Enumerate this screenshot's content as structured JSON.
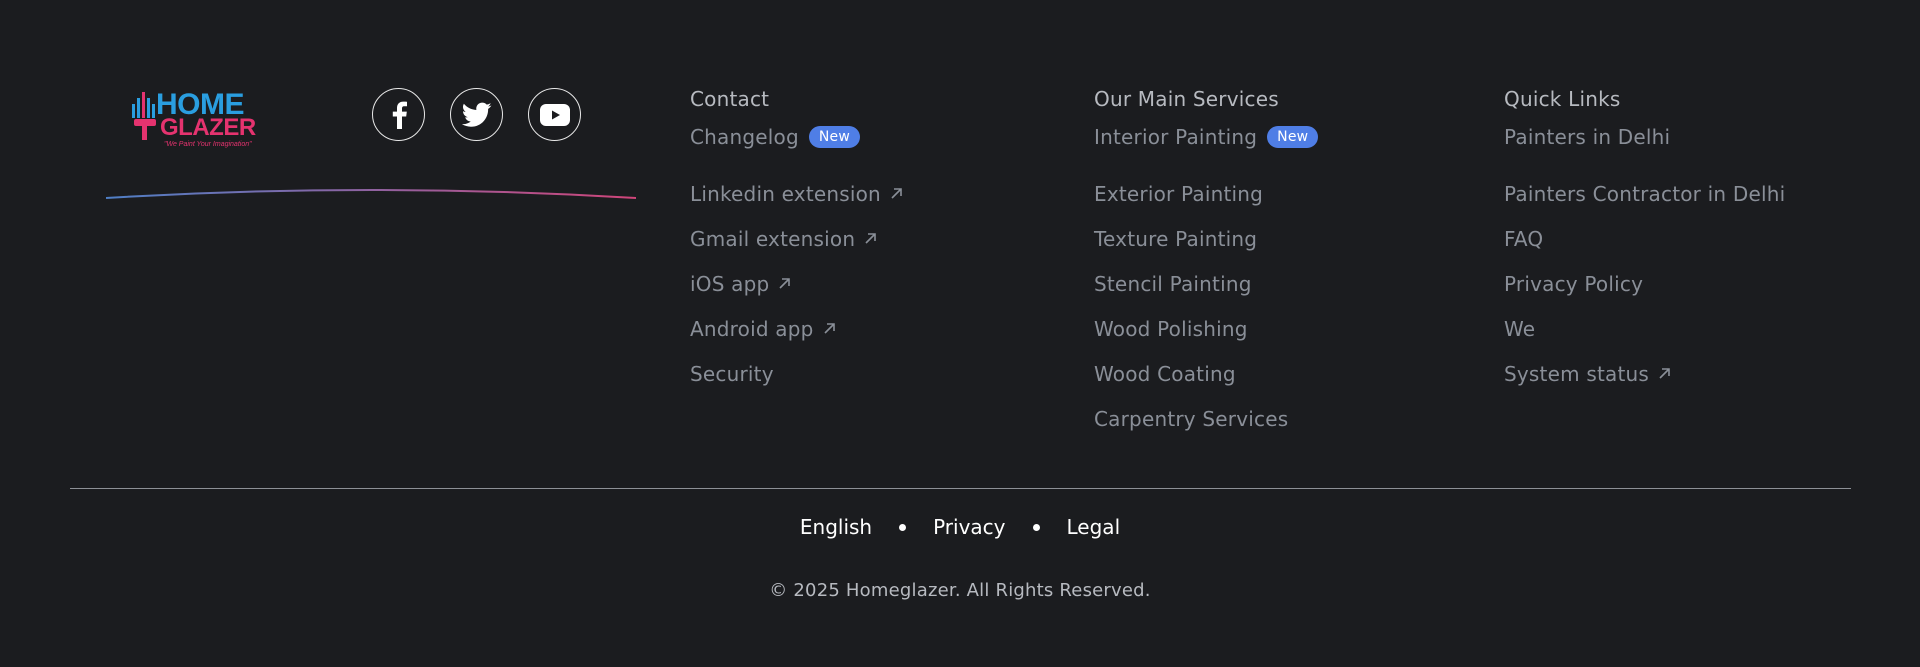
{
  "brand": {
    "logo_top": "HOME",
    "logo_bottom": "GLAZER",
    "logo_tagline": "\"We Paint Your Imagination\"",
    "colors": {
      "blue": "#2a9ee0",
      "pink": "#e5336f"
    },
    "socials": [
      {
        "name": "facebook",
        "icon": "facebook-icon"
      },
      {
        "name": "twitter",
        "icon": "twitter-icon"
      },
      {
        "name": "youtube",
        "icon": "youtube-icon"
      }
    ]
  },
  "contact": {
    "title": "Contact",
    "items": [
      {
        "label": "Changelog",
        "badge": "New"
      },
      {
        "label": "Linkedin extension",
        "external": true
      },
      {
        "label": "Gmail extension",
        "external": true
      },
      {
        "label": "iOS app",
        "external": true
      },
      {
        "label": "Android app",
        "external": true
      },
      {
        "label": "Security"
      }
    ]
  },
  "services": {
    "title": "Our Main Services",
    "items": [
      {
        "label": "Interior Painting",
        "badge": "New"
      },
      {
        "label": "Exterior Painting"
      },
      {
        "label": "Texture Painting"
      },
      {
        "label": "Stencil Painting"
      },
      {
        "label": "Wood Polishing"
      },
      {
        "label": "Wood Coating"
      },
      {
        "label": "Carpentry Services"
      }
    ]
  },
  "quick_links": {
    "title": "Quick Links",
    "items": [
      {
        "label": "Painters in Delhi"
      },
      {
        "label": "Painters Contractor in Delhi"
      },
      {
        "label": "FAQ"
      },
      {
        "label": "Privacy Policy"
      },
      {
        "label": "We"
      },
      {
        "label": "System status",
        "external": true
      }
    ]
  },
  "bottom": {
    "links": [
      "English",
      "Privacy",
      "Legal"
    ],
    "copyright": "© 2025 Homeglazer. All Rights Reserved."
  },
  "theme": {
    "background": "#1b1c1f",
    "badge": "#4f7ee6",
    "muted_text": "#8a8f98"
  }
}
